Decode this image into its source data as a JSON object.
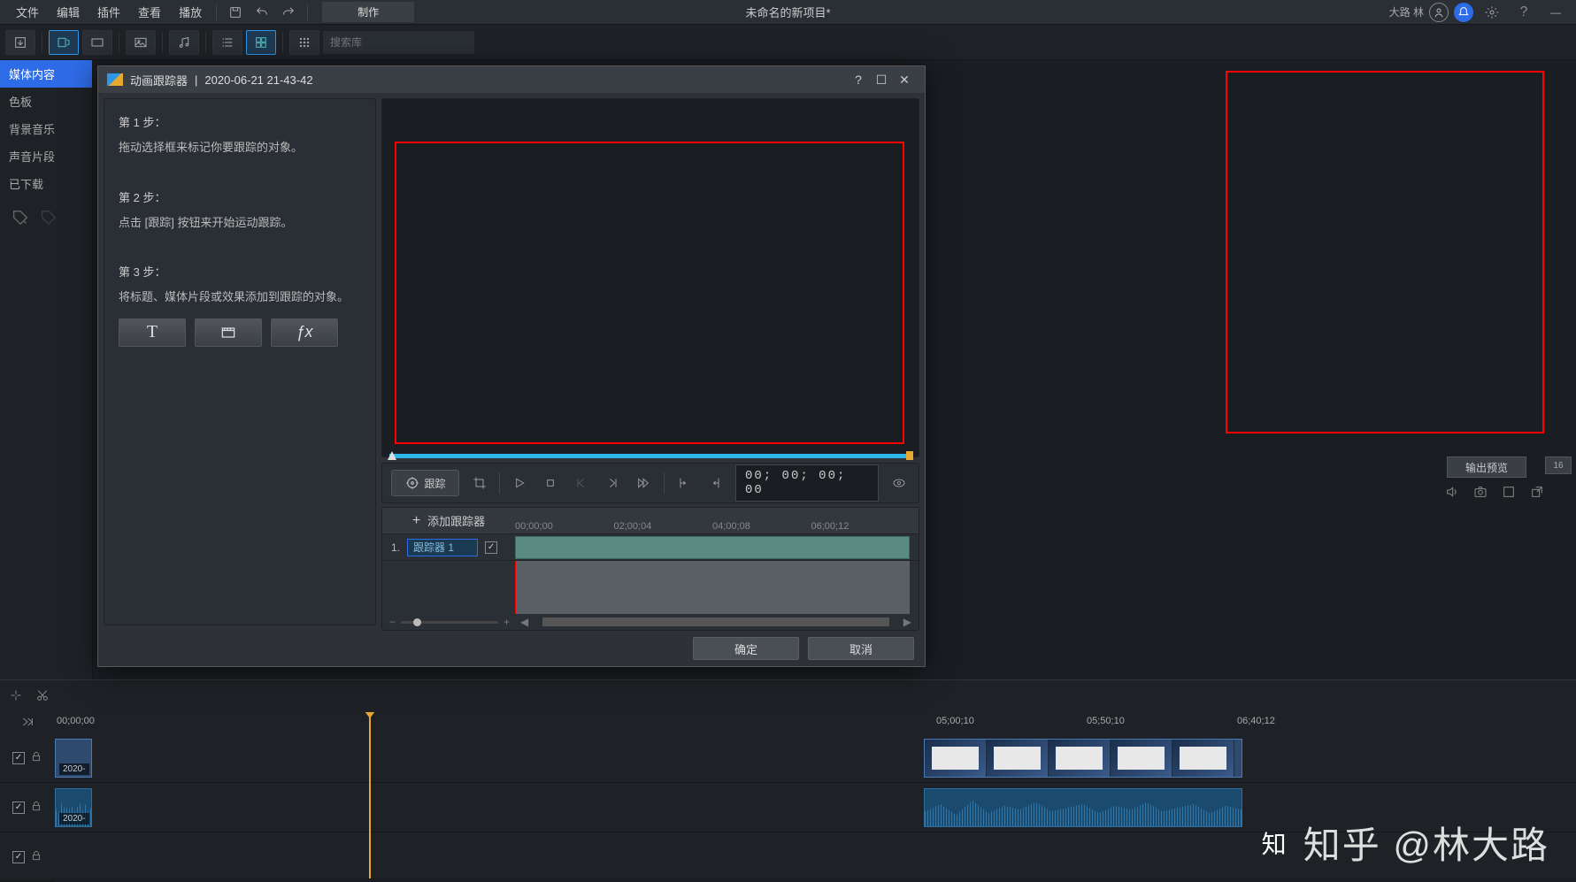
{
  "menubar": {
    "items": [
      "文件",
      "编辑",
      "插件",
      "查看",
      "播放"
    ],
    "produce": "制作",
    "project_title": "未命名的新项目*",
    "user": "大路 林"
  },
  "toolbar": {
    "search_placeholder": "搜索库"
  },
  "categories": [
    "媒体内容",
    "色板",
    "背景音乐",
    "声音片段",
    "已下载"
  ],
  "dialog": {
    "title": "动画跟踪器",
    "clip_name": "2020-06-21 21-43-42",
    "steps": [
      {
        "title": "第 1 步：",
        "text": "拖动选择框来标记你要跟踪的对象。"
      },
      {
        "title": "第 2 步：",
        "text": "点击 [跟踪] 按钮来开始运动跟踪。"
      },
      {
        "title": "第 3 步：",
        "text": "将标题、媒体片段或效果添加到跟踪的对象。"
      }
    ],
    "track_label": "跟踪",
    "timecode": "00; 00; 00; 00",
    "add_tracker": "添加跟踪器",
    "ruler": [
      "00;00;00",
      "02;00;04",
      "04;00;08",
      "06;00;12"
    ],
    "tracker_num": "1.",
    "tracker_name": "跟踪器 1",
    "ok": "确定",
    "cancel": "取消"
  },
  "right": {
    "output_preview": "输出预览",
    "zoom": "16"
  },
  "timeline": {
    "ruler": [
      "00;00;00",
      "05;00;10",
      "05;50;10",
      "06;40;12"
    ],
    "ruler_pos": [
      0,
      996,
      1166,
      1336
    ],
    "clip_label": "2020-"
  },
  "watermark": "知乎 @林大路"
}
